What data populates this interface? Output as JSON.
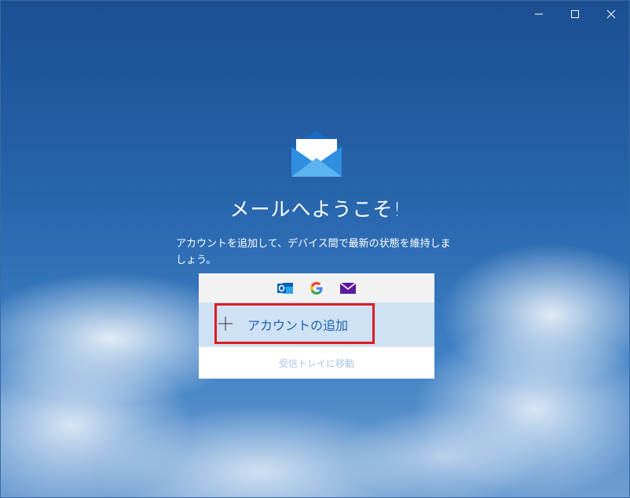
{
  "window": {
    "controls": {
      "minimize_icon": "minimize-icon",
      "maximize_icon": "maximize-icon",
      "close_icon": "close-icon"
    }
  },
  "welcome": {
    "logo_icon": "mail-envelope-icon",
    "title": "メールへようこそ!",
    "subtitle": "アカウントを追加して、デバイス間で最新の状態を維持しましょう。"
  },
  "accounts_card": {
    "providers": [
      {
        "name": "outlook-icon",
        "color": "#0a64b4"
      },
      {
        "name": "google-icon",
        "color": "#4285f4"
      },
      {
        "name": "yahoo-mail-icon",
        "color": "#5b1a9e"
      }
    ],
    "add_account_label": "アカウントの追加",
    "go_to_inbox_label": "受信トレイに移動"
  },
  "colors": {
    "highlight": "#e01b24",
    "accent": "#1f63ad",
    "selected_row": "#cfe1f4"
  }
}
